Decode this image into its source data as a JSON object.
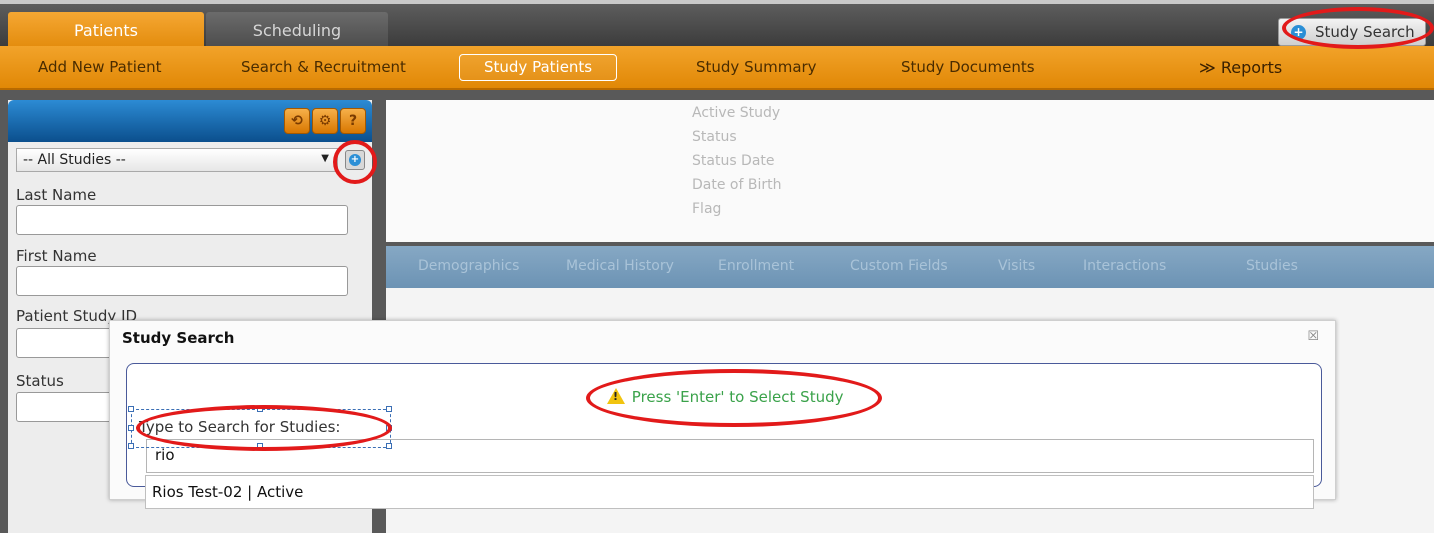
{
  "top_tabs": [
    {
      "label": "Patients",
      "active": true
    },
    {
      "label": "Scheduling",
      "active": false
    }
  ],
  "top_search_button": {
    "label": "Study Search",
    "icon": "plus-circle-icon"
  },
  "nav": {
    "items": [
      {
        "label": "Add New Patient"
      },
      {
        "label": "Search & Recruitment"
      },
      {
        "label": "Study Patients",
        "active": true
      },
      {
        "label": "Study Summary"
      },
      {
        "label": "Study Documents"
      },
      {
        "label": "Reports",
        "prefix": "≫"
      }
    ]
  },
  "left_panel": {
    "header_icons": [
      "refresh-icon",
      "settings-icon",
      "help-icon"
    ],
    "study_select": {
      "value": "-- All Studies --"
    },
    "fields": [
      {
        "label": "Last Name"
      },
      {
        "label": "First Name"
      },
      {
        "label": "Patient Study ID"
      },
      {
        "label": "Status"
      }
    ]
  },
  "info": {
    "lines": [
      "Active Study",
      "Status",
      "Status Date",
      "Date of Birth",
      "Flag"
    ]
  },
  "subtabs": [
    "Demographics",
    "Medical History",
    "Enrollment",
    "Custom Fields",
    "Visits",
    "Interactions",
    "Studies"
  ],
  "dialog": {
    "title": "Study Search",
    "close": "☒",
    "hint": "Press 'Enter' to Select Study",
    "search_label": "Type to Search for Studies:",
    "search_value": "rio",
    "suggestion": "Rios Test-02 | Active"
  },
  "colors": {
    "orange_nav": "#e99413",
    "header_blue": "#1a6bb0",
    "hint_green": "#3aa24a",
    "annotation_red": "#e21a1a"
  }
}
